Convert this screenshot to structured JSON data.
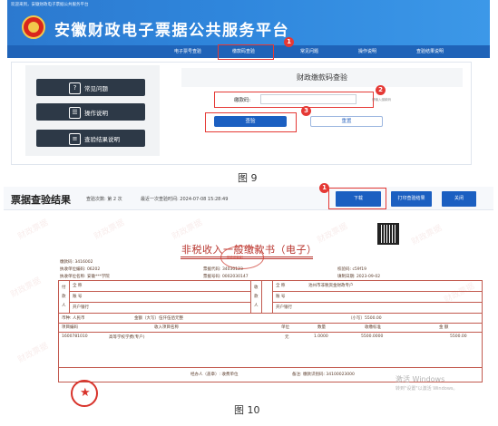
{
  "figure9": {
    "welcome_text": "欢迎来到，安徽财政电子票据公共服务平台",
    "site_title": "安徽财政电子票据公共服务平台",
    "nav": [
      {
        "label": "电子票号查验",
        "active": false
      },
      {
        "label": "缴款码查验",
        "active": true
      },
      {
        "label": "常见问题",
        "active": false
      },
      {
        "label": "操作说明",
        "active": false
      },
      {
        "label": "查验结果说明",
        "active": false
      }
    ],
    "sidebar": [
      {
        "label": "常见问题",
        "icon": "question-icon"
      },
      {
        "label": "操作说明",
        "icon": "guide-icon"
      },
      {
        "label": "查验结果说明",
        "icon": "document-icon"
      }
    ],
    "panel_title": "财政缴款码查验",
    "field_label": "缴款码:",
    "field_placeholder": "",
    "field_hint": "请输入缴款码",
    "query_button": "查验",
    "reset_button": "重置",
    "step_badges": [
      "1",
      "2",
      "3"
    ],
    "caption": "图 9"
  },
  "figure10": {
    "title": "票据查验结果",
    "query_count": "查验次数: 第 2 次",
    "last_query": "最近一次查验时间: 2024-07-08 15:28:49",
    "step_badge": "1",
    "buttons": {
      "download": "下载",
      "print": "打印查验结果",
      "close": "关闭"
    },
    "watermark": "财政票据",
    "invoice_title": "非税收入一般缴款书（电子）",
    "seal_oval_text": "财政部监制",
    "meta_left": [
      "缴款码: 3416002",
      "执收单位编码: 06202",
      "执收单位名称: 安徽***学院"
    ],
    "meta_mid": [
      "票据代码: 34030123",
      "票据号码: 0002030147"
    ],
    "meta_right": [
      "校验码: c59f19",
      "填制日期: 2023-09-02"
    ],
    "payer": {
      "label": "付款人",
      "rows": [
        "全 称",
        "账 号",
        "开户银行"
      ]
    },
    "payee": {
      "label": "收款人",
      "rows": [
        "全 称",
        "账 号",
        "开户银行"
      ],
      "name_value": "池州市非税资金财政专户"
    },
    "currency": "币种: 人民币",
    "amount_words": "金额（大写）伍仟伍佰元整",
    "amount_small": "（小写）5500.00",
    "table_headers": [
      "项目编码",
      "收入项目名称",
      "单位",
      "数量",
      "收缴标准",
      "金 额"
    ],
    "table_row": [
      "1600781010",
      "高等学校学费(专户)",
      "元",
      "1.0000",
      "5500.0000",
      "5500.00"
    ],
    "handler": "经办人（盖章）: 收费单位",
    "remark": "备注: 缴款识别码: 34100023000",
    "activate_title": "激活 Windows",
    "activate_sub": "转到\"设置\"以激活 Windows。",
    "caption": "图 10"
  }
}
